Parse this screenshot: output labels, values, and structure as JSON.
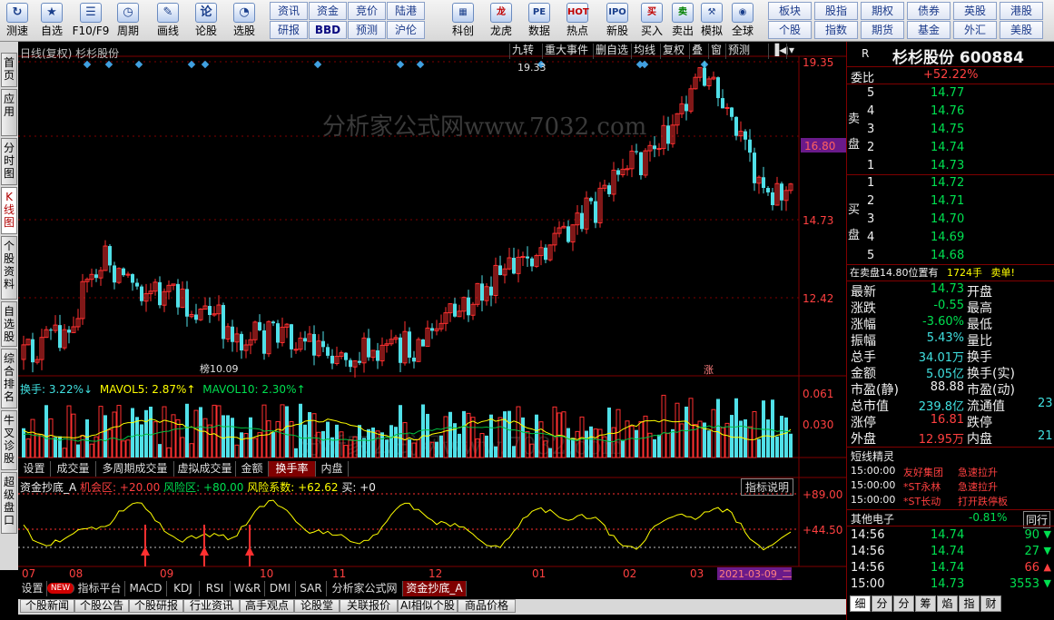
{
  "toolbar": {
    "buttons": [
      {
        "label": "测速",
        "icon": "↻"
      },
      {
        "label": "自选",
        "icon": "★"
      },
      {
        "label": "F10/F9",
        "icon": "☰"
      },
      {
        "label": "周期",
        "icon": "◷"
      },
      {
        "label": "画线",
        "icon": "✎"
      },
      {
        "label": "论股",
        "icon": "论"
      },
      {
        "label": "选股",
        "icon": "◔"
      }
    ],
    "grid1": [
      [
        "资讯",
        "资金",
        "竞价",
        "陆港"
      ],
      [
        "研报",
        "BBD",
        "预测",
        "沪伦"
      ]
    ],
    "icon_buttons": [
      {
        "label": "科创",
        "icon": "▦"
      },
      {
        "label": "龙虎",
        "icon": "龙"
      },
      {
        "label": "数据",
        "icon": "PE"
      },
      {
        "label": "热点",
        "icon": "HOT"
      },
      {
        "label": "新股",
        "icon": "IPO"
      },
      {
        "label": "买入",
        "icon": "买"
      },
      {
        "label": "卖出",
        "icon": "卖"
      },
      {
        "label": "模拟",
        "icon": "⚒"
      },
      {
        "label": "全球",
        "icon": "◉"
      }
    ],
    "grid2": [
      [
        "板块",
        "股指",
        "期权",
        "债券",
        "英股",
        "港股"
      ],
      [
        "个股",
        "指数",
        "期货",
        "基金",
        "外汇",
        "美股"
      ]
    ]
  },
  "left_tabs": [
    "首页",
    "应用",
    "分时图",
    "K线图",
    "个股资料",
    "自选股",
    "综合排名",
    "牛叉诊股",
    "超级盘口"
  ],
  "chart": {
    "title": "日线(复权) 杉杉股份",
    "top_buttons": [
      "九转",
      "重大事件",
      "删自选",
      "均线",
      "复权",
      "叠",
      "窗",
      "预测"
    ],
    "price_labels": [
      "19.35",
      "16.80",
      "14.73",
      "12.42"
    ],
    "current_price_label": "16.80",
    "high_mark": "19.33",
    "low_mark": "10.09",
    "low_prefix": "榜",
    "zhang_mark": "涨",
    "watermark": "分析家公式网www.7032.com",
    "volume_header": {
      "main": "换手: 3.22%↓",
      "mavol5": "MAVOL5: 2.87%↑",
      "mavol10": "MAVOL10: 2.30%↑"
    },
    "volume_labels": [
      "0.061",
      "0.030"
    ],
    "vol_tabs": [
      "设置",
      "成交量",
      "多周期成交量",
      "虚拟成交量",
      "金额",
      "换手率",
      "内盘"
    ],
    "active_vol_tab": "换手率",
    "indicator_header": {
      "name": "资金抄底_A",
      "jihui": "机会区: +20.00",
      "fengxian": "风险区: +80.00",
      "xishu": "风险系数: +62.62",
      "mai": "买: +0"
    },
    "indicator_help": "指标说明",
    "indicator_labels": [
      "+89.00",
      "+44.50"
    ],
    "month_labels": [
      "07",
      "08",
      "09",
      "10",
      "11",
      "12",
      "01",
      "02",
      "03"
    ],
    "date_box": "2021-03-09_二",
    "ind_tabs": [
      "设置",
      "NEW",
      "指标平台",
      "MACD",
      "KDJ",
      "RSI",
      "W&R",
      "DMI",
      "SAR",
      "分析家公式网",
      "资金抄底_A"
    ],
    "active_ind_tab": "资金抄底_A",
    "news_tabs": [
      "个股新闻",
      "个股公告",
      "个股研报",
      "行业资讯",
      "高手观点",
      "论股堂",
      "关联报价",
      "AI相似个股",
      "商品价格"
    ]
  },
  "right_panel": {
    "r_label": "R",
    "stock_name": "杉杉股份",
    "stock_code": "600884",
    "weibi_label": "委比",
    "weibi": "+52.22%",
    "sell_label": "卖盘",
    "buy_label": "买盘",
    "sells": [
      {
        "level": "5",
        "price": "14.77"
      },
      {
        "level": "4",
        "price": "14.76"
      },
      {
        "level": "3",
        "price": "14.75"
      },
      {
        "level": "2",
        "price": "14.74"
      },
      {
        "level": "1",
        "price": "14.73"
      }
    ],
    "buys": [
      {
        "level": "1",
        "price": "14.72"
      },
      {
        "level": "2",
        "price": "14.71"
      },
      {
        "level": "3",
        "price": "14.70"
      },
      {
        "level": "4",
        "price": "14.69"
      },
      {
        "level": "5",
        "price": "14.68"
      }
    ],
    "order_line": {
      "text": "在卖盘14.80位置有",
      "vol": "1724手",
      "tag": "卖单!"
    },
    "stats": [
      {
        "k": "最新",
        "v": "14.73",
        "c": "green",
        "k2": "开盘"
      },
      {
        "k": "涨跌",
        "v": "-0.55",
        "c": "green",
        "k2": "最高"
      },
      {
        "k": "涨幅",
        "v": "-3.60%",
        "c": "green",
        "k2": "最低"
      },
      {
        "k": "振幅",
        "v": "5.43%",
        "c": "cyan",
        "k2": "量比"
      },
      {
        "k": "总手",
        "v": "34.01万",
        "c": "cyan",
        "k2": "换手"
      },
      {
        "k": "金额",
        "v": "5.05亿",
        "c": "cyan",
        "k2": "换手(实)"
      },
      {
        "k": "市盈(静)",
        "v": "88.88",
        "c": "white",
        "k2": "市盈(动)"
      },
      {
        "k": "总市值",
        "v": "239.8亿",
        "c": "cyan",
        "k2": "流通值",
        "v2": "23"
      },
      {
        "k": "涨停",
        "v": "16.81",
        "c": "red",
        "k2": "跌停"
      },
      {
        "k": "外盘",
        "v": "12.95万",
        "c": "red",
        "k2": "内盘",
        "v2": "21"
      }
    ],
    "short_title": "短线精灵",
    "short_items": [
      {
        "time": "15:00:00",
        "name": "友好集团",
        "event": "急速拉升"
      },
      {
        "time": "15:00:00",
        "name": "*ST永林",
        "event": "急速拉升"
      },
      {
        "time": "15:00:00",
        "name": "*ST长动",
        "event": "打开跌停板"
      }
    ],
    "sector": {
      "name": "其他电子",
      "pct": "-0.81%",
      "tag": "同行"
    },
    "ticks": [
      {
        "time": "14:56",
        "price": "14.74",
        "vol": "90",
        "dir": "down"
      },
      {
        "time": "14:56",
        "price": "14.74",
        "vol": "27",
        "dir": "down"
      },
      {
        "time": "14:56",
        "price": "14.74",
        "vol": "66",
        "dir": "up"
      },
      {
        "time": "15:00",
        "price": "14.73",
        "vol": "3553",
        "dir": "down"
      }
    ],
    "bottom_tabs": [
      "细",
      "分",
      "分",
      "筹",
      "焰",
      "指",
      "财"
    ]
  }
}
